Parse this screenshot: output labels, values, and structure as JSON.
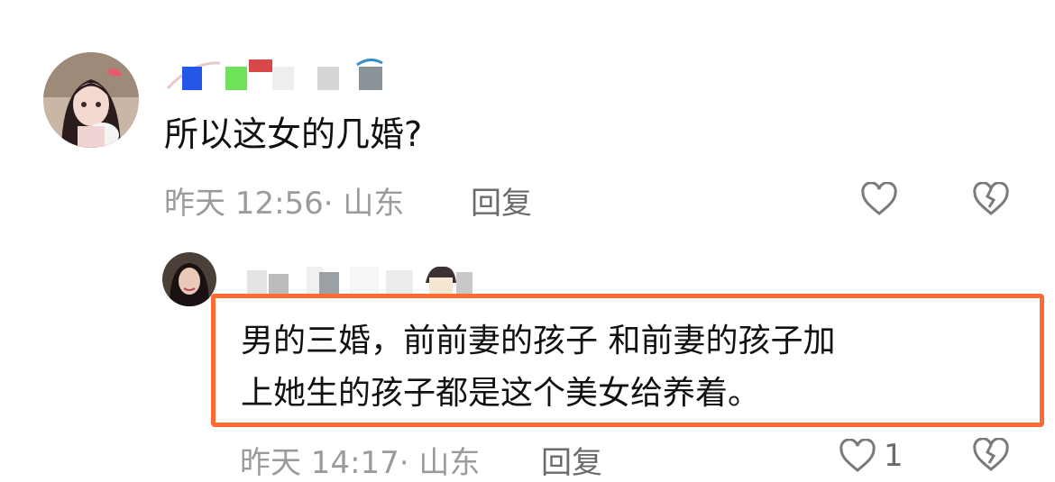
{
  "colors": {
    "meta_gray": "#9b9b9b",
    "action_gray": "#6b6b6b",
    "highlight_border": "#ff6a33",
    "icon_stroke": "#7a7a7a"
  },
  "comment": {
    "text": "所以这女的几婚?",
    "time_location": "昨天 12:56· 山东",
    "reply_label": "回复",
    "like_icon": "heart-outline-icon",
    "dislike_icon": "broken-heart-icon"
  },
  "reply": {
    "lines": [
      "男的三婚，前前妻的孩子 和前妻的孩子加",
      "上她生的孩子都是这个美女给养着。"
    ],
    "time_location": "昨天 14:17· 山东",
    "reply_label": "回复",
    "like_count": "1",
    "like_icon": "heart-outline-icon",
    "dislike_icon": "broken-heart-icon"
  }
}
